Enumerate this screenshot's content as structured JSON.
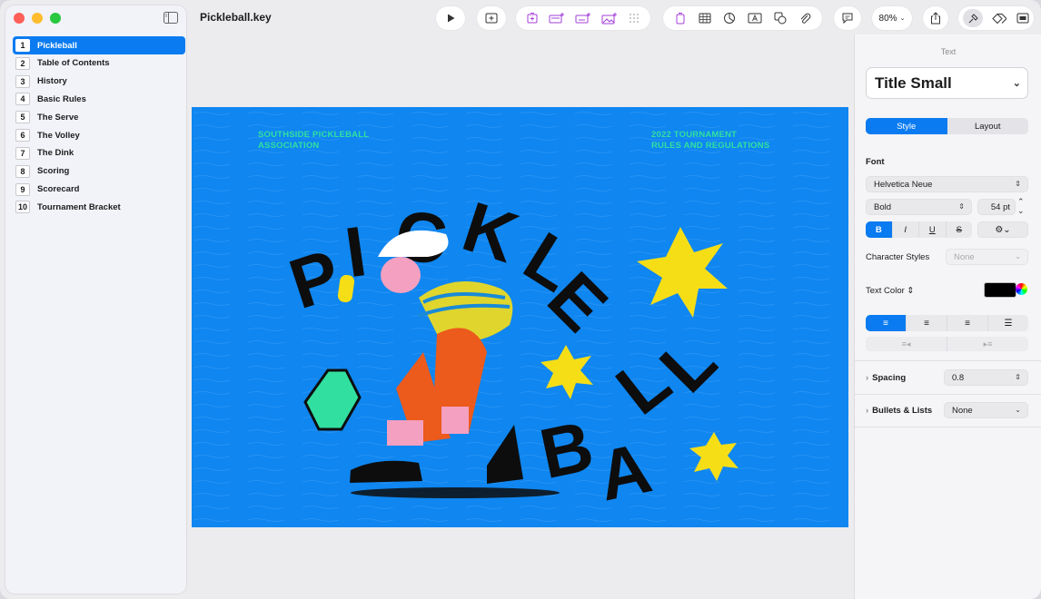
{
  "window": {
    "title": "Pickleball.key",
    "traffic_colors": [
      "#fe5f57",
      "#febc2e",
      "#28c840"
    ]
  },
  "sidebar": {
    "slides": [
      {
        "num": "1",
        "label": "Pickleball",
        "selected": true
      },
      {
        "num": "2",
        "label": "Table of Contents"
      },
      {
        "num": "3",
        "label": "History"
      },
      {
        "num": "4",
        "label": "Basic Rules"
      },
      {
        "num": "5",
        "label": "The Serve"
      },
      {
        "num": "6",
        "label": "The Volley"
      },
      {
        "num": "7",
        "label": "The Dink"
      },
      {
        "num": "8",
        "label": "Scoring"
      },
      {
        "num": "9",
        "label": "Scorecard"
      },
      {
        "num": "10",
        "label": "Tournament Bracket"
      }
    ]
  },
  "toolbar": {
    "zoom": "80%",
    "icons": [
      "play-icon",
      "add-slide-icon",
      "slide-layout-icon",
      "text-box-icon",
      "shape-icon",
      "image-icon",
      "grid-icon",
      "table-icon",
      "chart-icon",
      "text-icon",
      "shapes-icon",
      "media-icon",
      "comment-icon",
      "share-icon",
      "format-icon",
      "animate-icon",
      "document-icon"
    ]
  },
  "slide": {
    "top_left_text": "SOUTHSIDE PICKLEBALL\nASSOCIATION",
    "top_right_text": "2022 TOURNAMENT\nRULES AND REGULATIONS",
    "background_color": "#0f86f0",
    "word1": "PICKLE",
    "word2": "BALL"
  },
  "inspector": {
    "header": "Text",
    "paragraph_style": "Title Small",
    "tabs": [
      "Style",
      "Layout"
    ],
    "font_section": "Font",
    "font_family": "Helvetica Neue",
    "font_weight": "Bold",
    "font_size": "54 pt",
    "format_buttons": [
      "B",
      "I",
      "U",
      "S"
    ],
    "character_styles_label": "Character Styles",
    "character_styles_value": "None",
    "text_color_label": "Text Color ⇕",
    "spacing_label": "Spacing",
    "spacing_value": "0.8",
    "bullets_label": "Bullets & Lists",
    "bullets_value": "None",
    "accent": "#0a7bf0"
  }
}
